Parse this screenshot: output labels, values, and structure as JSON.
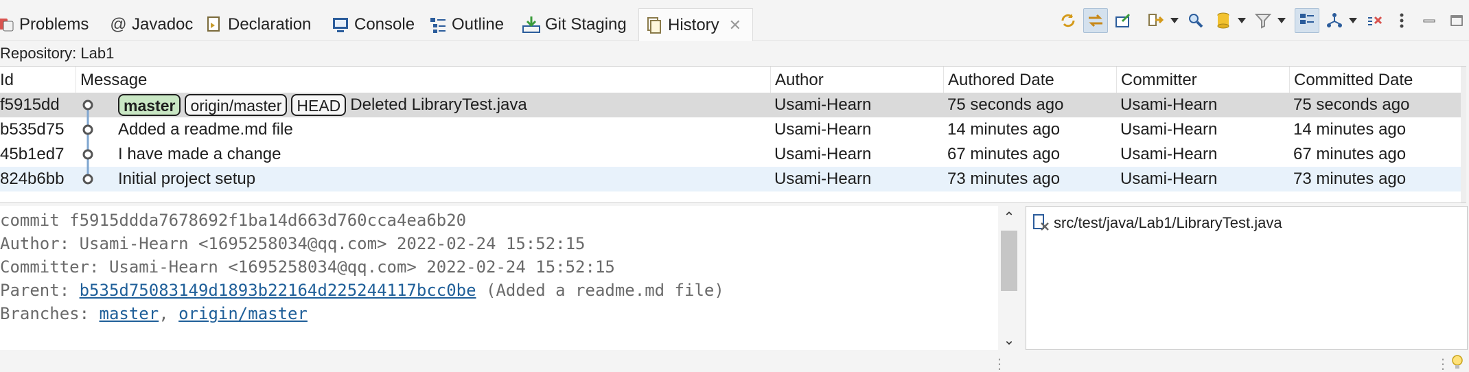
{
  "tabs": [
    {
      "label": "Problems",
      "icon": "problems-icon"
    },
    {
      "label": "Javadoc",
      "icon": "javadoc-icon"
    },
    {
      "label": "Declaration",
      "icon": "declaration-icon"
    },
    {
      "label": "Console",
      "icon": "console-icon"
    },
    {
      "label": "Outline",
      "icon": "outline-icon"
    },
    {
      "label": "Git Staging",
      "icon": "git-staging-icon"
    },
    {
      "label": "History",
      "icon": "history-icon",
      "active": true
    }
  ],
  "repository_label": "Repository: Lab1",
  "table": {
    "columns": [
      "Id",
      "Message",
      "Author",
      "Authored Date",
      "Committer",
      "Committed Date"
    ],
    "rows": [
      {
        "id": "f5915dd",
        "refs": [
          "master",
          "origin/master",
          "HEAD"
        ],
        "message": "Deleted LibraryTest.java",
        "author": "Usami-Hearn",
        "authored": "75 seconds ago",
        "committer": "Usami-Hearn",
        "committed": "75 seconds ago"
      },
      {
        "id": "b535d75",
        "refs": [],
        "message": "Added a readme.md file",
        "author": "Usami-Hearn",
        "authored": "14 minutes ago",
        "committer": "Usami-Hearn",
        "committed": "14 minutes ago"
      },
      {
        "id": "45b1ed7",
        "refs": [],
        "message": "I have made a change",
        "author": "Usami-Hearn",
        "authored": "67 minutes ago",
        "committer": "Usami-Hearn",
        "committed": "67 minutes ago"
      },
      {
        "id": "824b6bb",
        "refs": [],
        "message": "Initial project setup",
        "author": "Usami-Hearn",
        "authored": "73 minutes ago",
        "committer": "Usami-Hearn",
        "committed": "73 minutes ago"
      }
    ]
  },
  "details": {
    "commit_line": "commit f5915ddda7678692f1ba14d663d760cca4ea6b20",
    "author_line": "Author: Usami-Hearn <1695258034@qq.com> 2022-02-24 15:52:15",
    "committer_line": "Committer: Usami-Hearn <1695258034@qq.com> 2022-02-24 15:52:15",
    "parent_prefix": "Parent: ",
    "parent_hash": "b535d75083149d1893b22164d225244117bcc0be",
    "parent_suffix": " (Added a readme.md file)",
    "branches_prefix": "Branches: ",
    "branch_1": "master",
    "branch_sep": ", ",
    "branch_2": "origin/master"
  },
  "files": [
    "src/test/java/Lab1/LibraryTest.java"
  ],
  "colors": {
    "selected_row": "#dadada",
    "alt_row": "#e8f2fb",
    "master_ref": "#c9e7c4",
    "link": "#1f5f99",
    "graph_line": "#7fa6d0"
  }
}
